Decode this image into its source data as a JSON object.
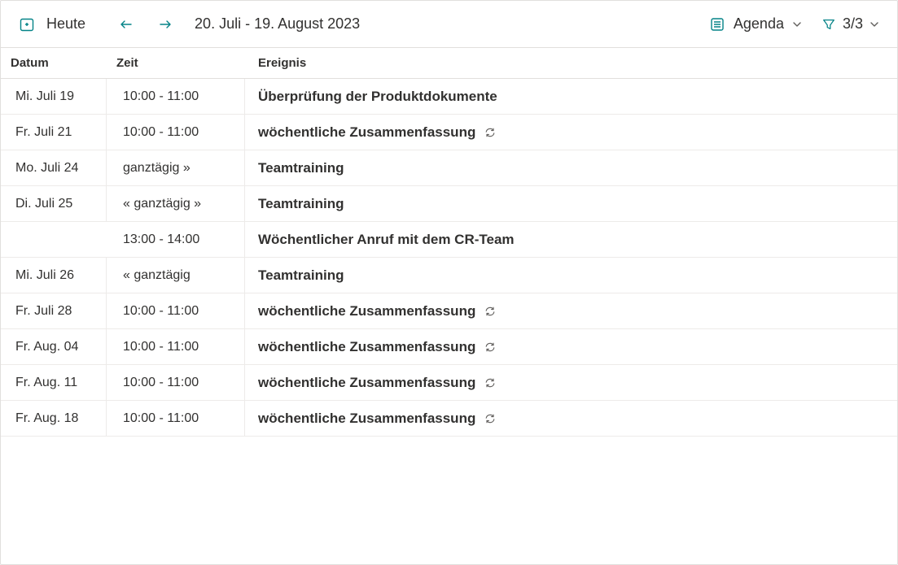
{
  "toolbar": {
    "today_label": "Heute",
    "date_range": "20. Juli - 19. August 2023",
    "view_label": "Agenda",
    "filter_count": "3/3"
  },
  "columns": {
    "date": "Datum",
    "time": "Zeit",
    "event": "Ereignis"
  },
  "rows": [
    {
      "date": "Mi. Juli 19",
      "time": "10:00 - 11:00",
      "event": "Überprüfung der Produktdokumente",
      "recurring": false
    },
    {
      "date": "Fr. Juli 21",
      "time": "10:00 - 11:00",
      "event": "wöchentliche Zusammenfassung",
      "recurring": true
    },
    {
      "date": "Mo. Juli 24",
      "time": "ganztägig »",
      "event": "Teamtraining",
      "recurring": false
    },
    {
      "date": "Di. Juli 25",
      "time": "« ganztägig »",
      "event": "Teamtraining",
      "recurring": false
    },
    {
      "date": "",
      "time": "13:00 - 14:00",
      "event": "Wöchentlicher Anruf mit dem CR-Team",
      "recurring": false
    },
    {
      "date": "Mi. Juli 26",
      "time": "« ganztägig",
      "event": "Teamtraining",
      "recurring": false
    },
    {
      "date": "Fr. Juli 28",
      "time": "10:00 - 11:00",
      "event": "wöchentliche Zusammenfassung",
      "recurring": true
    },
    {
      "date": "Fr. Aug. 04",
      "time": "10:00 - 11:00",
      "event": "wöchentliche Zusammenfassung",
      "recurring": true
    },
    {
      "date": "Fr. Aug. 11",
      "time": "10:00 - 11:00",
      "event": "wöchentliche Zusammenfassung",
      "recurring": true
    },
    {
      "date": "Fr. Aug. 18",
      "time": "10:00 - 11:00",
      "event": "wöchentliche Zusammenfassung",
      "recurring": true
    }
  ]
}
